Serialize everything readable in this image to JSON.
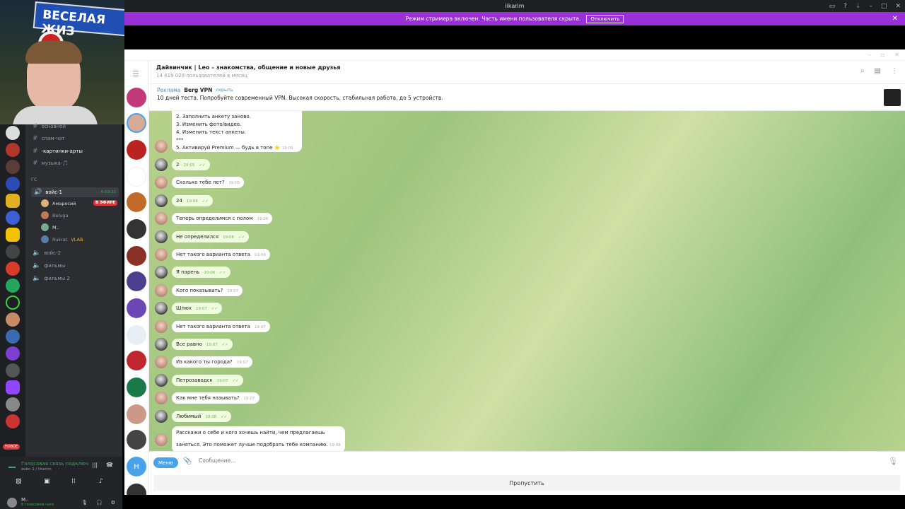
{
  "window": {
    "title": "likarim"
  },
  "banner": {
    "text": "Режим стримера включен. Часть имени пользователя скрыта.",
    "button": "Отключить"
  },
  "webcam": {
    "sign_text": "ВЕСЕЛАЯ ЖИЗ"
  },
  "discord": {
    "channels": [
      {
        "label": "основной",
        "type": "text"
      },
      {
        "label": "спам-чат",
        "type": "text"
      },
      {
        "label": "-картинки-арты",
        "type": "text",
        "bold": true
      },
      {
        "label": "музыка-🎵",
        "type": "text"
      }
    ],
    "category": "ГС",
    "voice_active": {
      "label": "войс-1",
      "time": "6:03:22"
    },
    "voice_users": [
      {
        "name": "Амаросий",
        "badge": "В ЭФИРЕ"
      },
      {
        "name": "Beluga"
      },
      {
        "name": "M.."
      },
      {
        "name": "Rukrat",
        "tag": "VLAB"
      }
    ],
    "voice_channels": [
      "войс-2",
      "фильмы",
      "фильмы 2"
    ],
    "new_badge": "НОВОЕ",
    "voice_status": "Голосовая связь подключ",
    "voice_sub": "войс-1 / likarim",
    "user": {
      "name": "M..",
      "status": "В голосовом чате"
    }
  },
  "telegram": {
    "chat_title": "Дайвинчик | Leo – знакомства, общение и новые друзья",
    "chat_subtitle": "14 419 029 пользователей в месяц",
    "ad": {
      "label": "Реклама",
      "name": "Berg VPN",
      "hide": "скрыть",
      "text": "10 дней теста. Попробуйте современный VPN. Высокая скорость, стабильная работа, до 5 устройств."
    },
    "first_message": {
      "lines": [
        "2. Заполнить анкету заново.",
        "3. Изменить фото/видео.",
        "4. Изменить текст анкеты.",
        "***",
        "5. Активируй Premium — будь в топе ⭐"
      ],
      "time": "19:05"
    },
    "messages": [
      {
        "text": "2",
        "time": "19:05",
        "out": true
      },
      {
        "text": "Сколько тебе лет?",
        "time": "19:05",
        "out": false
      },
      {
        "text": "24",
        "time": "19:06",
        "out": true
      },
      {
        "text": "Теперь определимся с полом",
        "time": "19:06",
        "out": false
      },
      {
        "text": "Не определился",
        "time": "19:06",
        "out": true
      },
      {
        "text": "Нет такого варианта ответа",
        "time": "19:06",
        "out": false
      },
      {
        "text": "Я парень",
        "time": "19:06",
        "out": true
      },
      {
        "text": "Кого показывать?",
        "time": "19:07",
        "out": false
      },
      {
        "text": "Шлюх",
        "time": "19:07",
        "out": true
      },
      {
        "text": "Нет такого варианта ответа",
        "time": "19:07",
        "out": false
      },
      {
        "text": "Все равно",
        "time": "19:07",
        "out": true
      },
      {
        "text": "Из какого ты города?",
        "time": "19:07",
        "out": false
      },
      {
        "text": "Петрозаводск",
        "time": "19:07",
        "out": true
      },
      {
        "text": "Как мне тебя называть?",
        "time": "19:07",
        "out": false
      },
      {
        "text": "Любимый",
        "time": "19:08",
        "out": true
      }
    ],
    "last_message": {
      "lines": [
        "Расскажи о себе и кого хочешь найти, чем предлагаешь",
        "заняться. Это поможет лучше подобрать тебе компанию."
      ],
      "time": "19:08"
    },
    "composer": {
      "menu": "Меню",
      "placeholder": "Сообщение..."
    },
    "skip": "Пропустить",
    "rail_letter": "Н"
  },
  "colors": {
    "banner": "#9b30d9",
    "accent": "#4aa3ea",
    "discord_bg": "#2b2d31",
    "live": "#da373c"
  }
}
